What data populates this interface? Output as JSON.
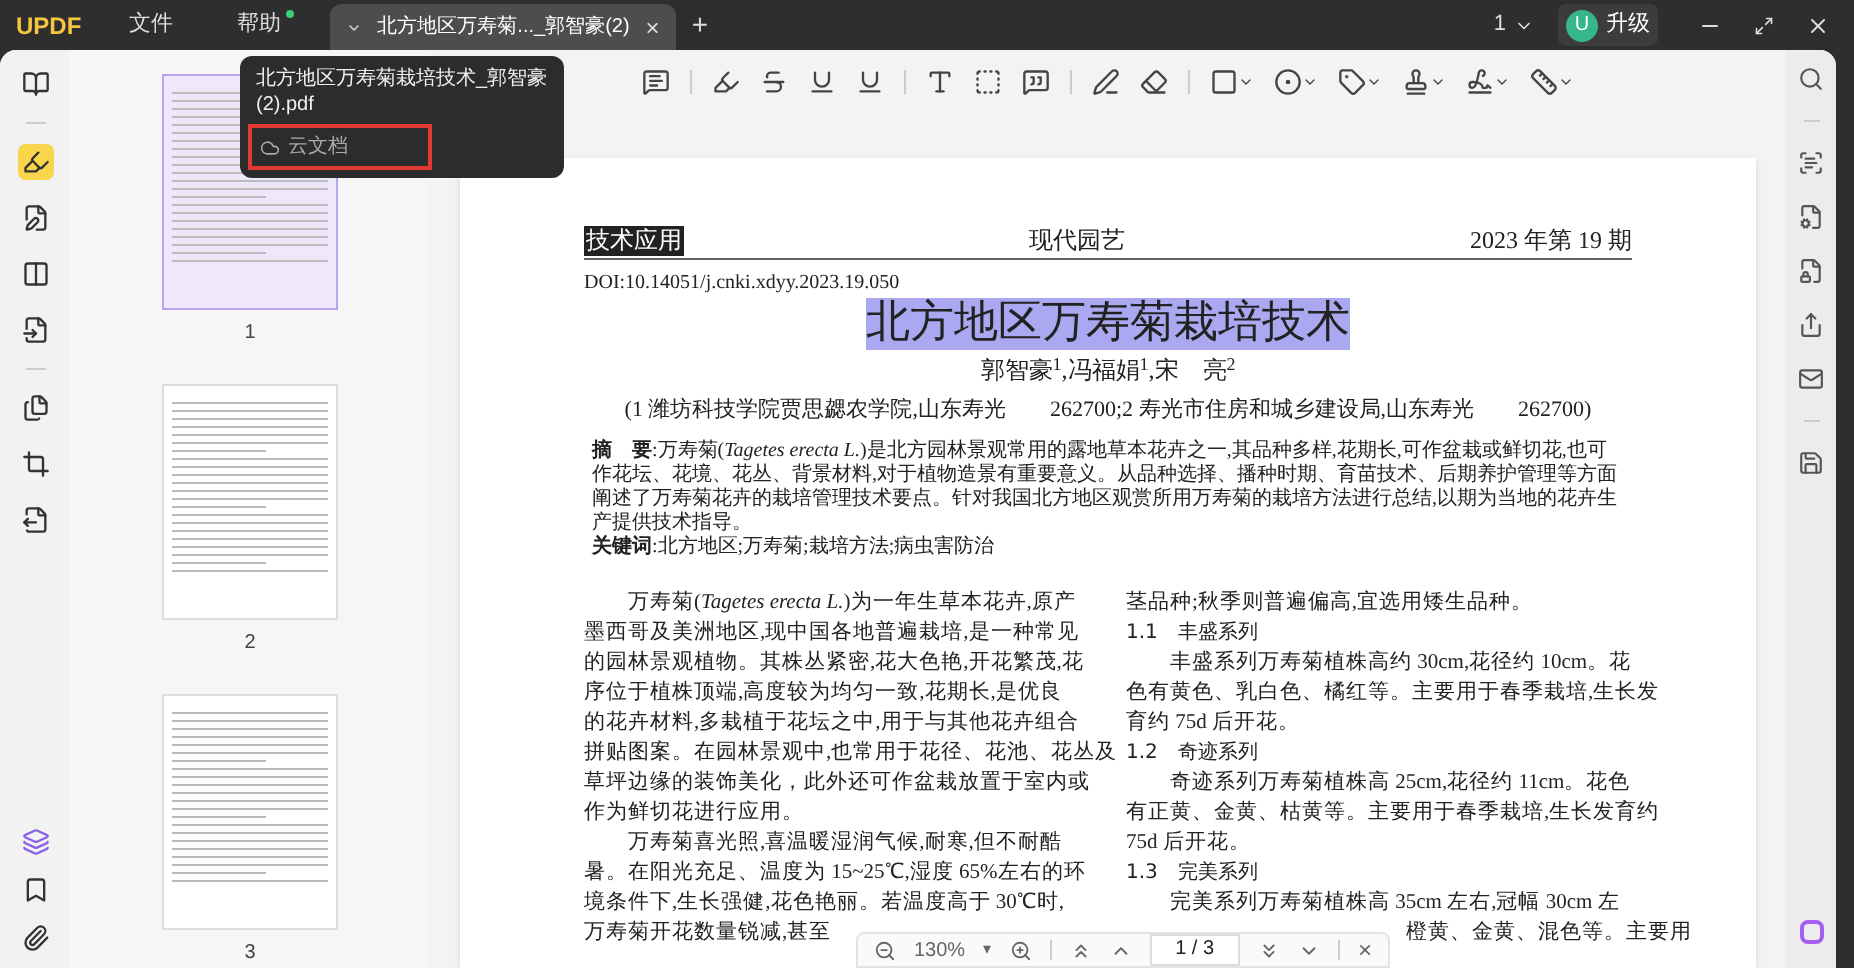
{
  "app": {
    "logo": "UPDF",
    "menu": [
      "文件",
      "帮助"
    ],
    "help_has_update": true
  },
  "tab": {
    "title": "北方地区万寿菊..._郭智豪(2)",
    "close": "×",
    "new": "+"
  },
  "window_controls": {
    "page_switch": "1",
    "avatar": "U",
    "upgrade": "升级"
  },
  "tooltip": {
    "file_name": "北方地区万寿菊栽培技术_郭智豪(2).pdf",
    "location": "云文档",
    "highlighted": true
  },
  "left_rail": [
    {
      "selected": false
    },
    {
      "selected": true
    },
    {
      "selected": false
    },
    {
      "selected": false
    },
    {
      "selected": false
    },
    {
      "selected": false
    },
    {
      "selected": false
    },
    {
      "selected": false
    }
  ],
  "thumbnails": [
    {
      "label": "1",
      "selected": true
    },
    {
      "label": "2",
      "selected": false
    },
    {
      "label": "3",
      "selected": false
    }
  ],
  "toolbar": [
    {
      "dropdown": false
    },
    {
      "dropdown": false
    },
    {
      "dropdown": false
    },
    {
      "dropdown": false
    },
    {
      "dropdown": false
    },
    {
      "dropdown": false
    },
    {
      "dropdown": false
    },
    {
      "dropdown": false
    },
    {
      "dropdown": false
    },
    {
      "dropdown": false
    },
    {
      "dropdown": true
    },
    {
      "dropdown": true
    },
    {
      "dropdown": true
    },
    {
      "dropdown": true
    },
    {
      "dropdown": true
    },
    {
      "dropdown": true
    }
  ],
  "page": {
    "section": "技术应用",
    "journal": "现代园艺",
    "issue": "2023 年第 19 期",
    "doi": "DOI:10.14051/j.cnki.xdyy.2023.19.050",
    "title": "北方地区万寿菊栽培技术",
    "title_selected": true,
    "authors": "郭智豪$^{1}$,冯福娟$^{1}$,宋　亮$^{2}$",
    "affiliation": "(1 潍坊科技学院贾思勰农学院,山东寿光　　262700;2 寿光市住房和城乡建设局,山东寿光　　262700)",
    "abstract": "**摘　要**:万寿菊(*Tagetes erecta L.*)是北方园林景观常用的露地草本花卉之一,其品种多样,花期长,可作盆栽或鲜切花,也可作花坛、花境、花丛、背景材料,对于植物造景有重要意义。从品种选择、播种时期、育苗技术、后期养护管理等方面阐述了万寿菊花卉的栽培管理技术要点。针对我国北方地区观赏所用万寿菊的栽培方法进行总结,以期为当地的花卉生产提供技术指导。",
    "keywords": "**关键词**:北方地区;万寿菊;栽培方法;病虫害防治",
    "column_1": [
      {
        "kind": "first",
        "text": "万寿菊(*Tagetes erecta L.*)为一年生草本花卉,原产"
      },
      {
        "kind": "line",
        "text": "墨西哥及美洲地区,现中国各地普遍栽培,是一种常见"
      },
      {
        "kind": "line",
        "text": "的园林景观植物。其株丛紧密,花大色艳,开花繁茂,花"
      },
      {
        "kind": "line",
        "text": "序位于植株顶端,高度较为均匀一致,花期长,是优良"
      },
      {
        "kind": "line",
        "text": "的花卉材料,多栽植于花坛之中,用于与其他花卉组合"
      },
      {
        "kind": "line",
        "text": "拼贴图案。在园林景观中,也常用于花径、花池、花丛及"
      },
      {
        "kind": "line",
        "text": "草坪边缘的装饰美化，此外还可作盆栽放置于室内或"
      },
      {
        "kind": "line",
        "text": "作为鲜切花进行应用。"
      },
      {
        "kind": "first",
        "text": "万寿菊喜光照,喜温暖湿润气候,耐寒,但不耐酷"
      },
      {
        "kind": "line",
        "text": "暑。在阳光充足、温度为 15~25℃,湿度 65%左右的环"
      },
      {
        "kind": "line",
        "text": "境条件下,生长强健,花色艳丽。若温度高于 30℃时,"
      },
      {
        "kind": "line",
        "text": "万寿菊开花数量锐减,甚至"
      }
    ],
    "column_2": [
      {
        "kind": "line",
        "text": "茎品种;秋季则普遍偏高,宜选用矮生品种。"
      },
      {
        "kind": "heading",
        "text": "1.1　丰盛系列"
      },
      {
        "kind": "first",
        "text": "丰盛系列万寿菊植株高约 30cm,花径约 10cm。花"
      },
      {
        "kind": "line",
        "text": "色有黄色、乳白色、橘红等。主要用于春季栽培,生长发"
      },
      {
        "kind": "line",
        "text": "育约 75d 后开花。"
      },
      {
        "kind": "heading",
        "text": "1.2　奇迹系列"
      },
      {
        "kind": "first",
        "text": "奇迹系列万寿菊植株高 25cm,花径约 11cm。花色"
      },
      {
        "kind": "line",
        "text": "有正黄、金黄、枯黄等。主要用于春季栽培,生长发育约"
      },
      {
        "kind": "line",
        "text": "75d 后开花。"
      },
      {
        "kind": "heading",
        "text": "1.3　完美系列"
      },
      {
        "kind": "first",
        "text": "完美系列万寿菊植株高 35cm 左右,冠幅 30cm 左"
      },
      {
        "kind": "partial",
        "text": "橙黄、金黄、混色等。主要用"
      }
    ]
  },
  "page_bar": {
    "zoom": "130%",
    "zoom_caret": "▾",
    "page": "1 / 3",
    "close": "×"
  }
}
